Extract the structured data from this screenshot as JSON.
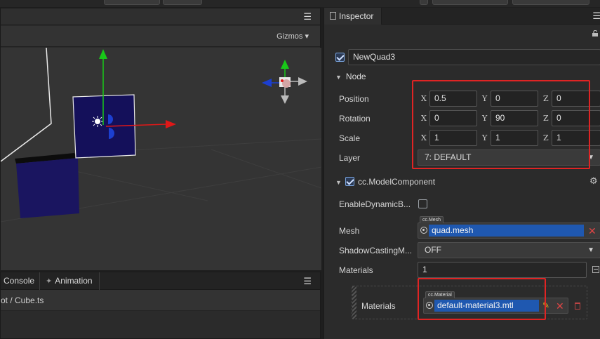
{
  "scene": {
    "gizmos_label": "Gizmos"
  },
  "bottom": {
    "tabs": [
      {
        "label": "Console",
        "icon": ""
      },
      {
        "label": "Animation",
        "icon": "animation-icon"
      }
    ],
    "path_text": "ot / Cube.ts"
  },
  "inspector": {
    "tab_label": "Inspector",
    "node_name": "NewQuad3",
    "node_enabled": true,
    "node_section": "Node",
    "position": {
      "label": "Position",
      "x": "0.5",
      "y": "0",
      "z": "0"
    },
    "rotation": {
      "label": "Rotation",
      "x": "0",
      "y": "90",
      "z": "0"
    },
    "scale": {
      "label": "Scale",
      "x": "1",
      "y": "1",
      "z": "1"
    },
    "axes": {
      "x": "X",
      "y": "Y",
      "z": "Z"
    },
    "layer": {
      "label": "Layer",
      "value": "7: DEFAULT"
    },
    "component": {
      "title": "cc.ModelComponent",
      "enabled": true,
      "enable_dynamic_label": "EnableDynamicB...",
      "enable_dynamic_checked": false,
      "mesh_label": "Mesh",
      "mesh_tag": "cc.Mesh",
      "mesh_value": "quad.mesh",
      "shadow_label": "ShadowCastingM...",
      "shadow_value": "OFF",
      "materials_label": "Materials",
      "materials_count": "1",
      "material_item_label": "Materials",
      "material_tag": "cc.Material",
      "material_value": "default-material3.mtl"
    }
  },
  "colors": {
    "accent_blue": "#1f58b0",
    "highlight_red": "#e02424",
    "remove_red": "#e04545"
  }
}
